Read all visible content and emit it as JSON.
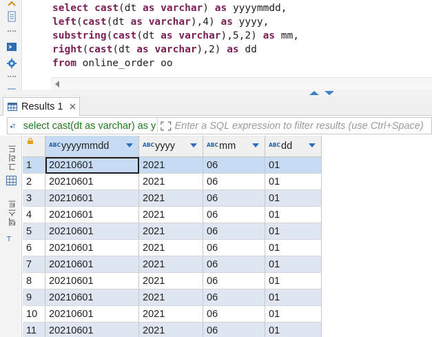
{
  "editor": {
    "lines": [
      [
        {
          "t": "select",
          "k": "kw"
        },
        {
          "t": " "
        },
        {
          "t": "cast",
          "k": "fn"
        },
        {
          "t": "(dt "
        },
        {
          "t": "as",
          "k": "kw"
        },
        {
          "t": " "
        },
        {
          "t": "varchar",
          "k": "kw"
        },
        {
          "t": ") "
        },
        {
          "t": "as",
          "k": "kw"
        },
        {
          "t": " yyyymmdd,"
        }
      ],
      [
        {
          "t": "left",
          "k": "fn"
        },
        {
          "t": "("
        },
        {
          "t": "cast",
          "k": "fn"
        },
        {
          "t": "(dt "
        },
        {
          "t": "as",
          "k": "kw"
        },
        {
          "t": " "
        },
        {
          "t": "varchar",
          "k": "kw"
        },
        {
          "t": "),4) "
        },
        {
          "t": "as",
          "k": "kw"
        },
        {
          "t": " yyyy,"
        }
      ],
      [
        {
          "t": "substring",
          "k": "fn"
        },
        {
          "t": "("
        },
        {
          "t": "cast",
          "k": "fn"
        },
        {
          "t": "(dt "
        },
        {
          "t": "as",
          "k": "kw"
        },
        {
          "t": " "
        },
        {
          "t": "varchar",
          "k": "kw"
        },
        {
          "t": "),5,2) "
        },
        {
          "t": "as",
          "k": "kw"
        },
        {
          "t": " mm,"
        }
      ],
      [
        {
          "t": "right",
          "k": "fn"
        },
        {
          "t": "("
        },
        {
          "t": "cast",
          "k": "fn"
        },
        {
          "t": "(dt "
        },
        {
          "t": "as",
          "k": "kw"
        },
        {
          "t": " "
        },
        {
          "t": "varchar",
          "k": "kw"
        },
        {
          "t": "),2) "
        },
        {
          "t": "as",
          "k": "kw"
        },
        {
          "t": " dd"
        }
      ],
      [
        {
          "t": "from",
          "k": "kw"
        },
        {
          "t": " online_order oo"
        }
      ]
    ]
  },
  "results_tab": {
    "label": "Results 1",
    "close_glyph": "×"
  },
  "filter": {
    "query_text": "select cast(dt as varchar) as yyyymmdd",
    "placeholder": "Enter a SQL expression to filter results (use Ctrl+Space)"
  },
  "side_tabs": {
    "grid_label": "그리드",
    "text_label": "텍스트"
  },
  "grid": {
    "type_badge": "ABC",
    "columns": [
      "yyyymmdd",
      "yyyy",
      "mm",
      "dd"
    ],
    "rows": [
      {
        "num": "1",
        "cells": [
          "20210601",
          "2021",
          "06",
          "01"
        ]
      },
      {
        "num": "2",
        "cells": [
          "20210601",
          "2021",
          "06",
          "01"
        ]
      },
      {
        "num": "3",
        "cells": [
          "20210601",
          "2021",
          "06",
          "01"
        ]
      },
      {
        "num": "4",
        "cells": [
          "20210601",
          "2021",
          "06",
          "01"
        ]
      },
      {
        "num": "5",
        "cells": [
          "20210601",
          "2021",
          "06",
          "01"
        ]
      },
      {
        "num": "6",
        "cells": [
          "20210601",
          "2021",
          "06",
          "01"
        ]
      },
      {
        "num": "7",
        "cells": [
          "20210601",
          "2021",
          "06",
          "01"
        ]
      },
      {
        "num": "8",
        "cells": [
          "20210601",
          "2021",
          "06",
          "01"
        ]
      },
      {
        "num": "9",
        "cells": [
          "20210601",
          "2021",
          "06",
          "01"
        ]
      },
      {
        "num": "10",
        "cells": [
          "20210601",
          "2021",
          "06",
          "01"
        ]
      },
      {
        "num": "11",
        "cells": [
          "20210601",
          "2021",
          "06",
          "01"
        ]
      }
    ]
  },
  "colors": {
    "keyword": "#7a1f54",
    "selection": "#c7dcf3",
    "alt_row": "#dde6f1",
    "filter_query": "#1f7a1f"
  }
}
